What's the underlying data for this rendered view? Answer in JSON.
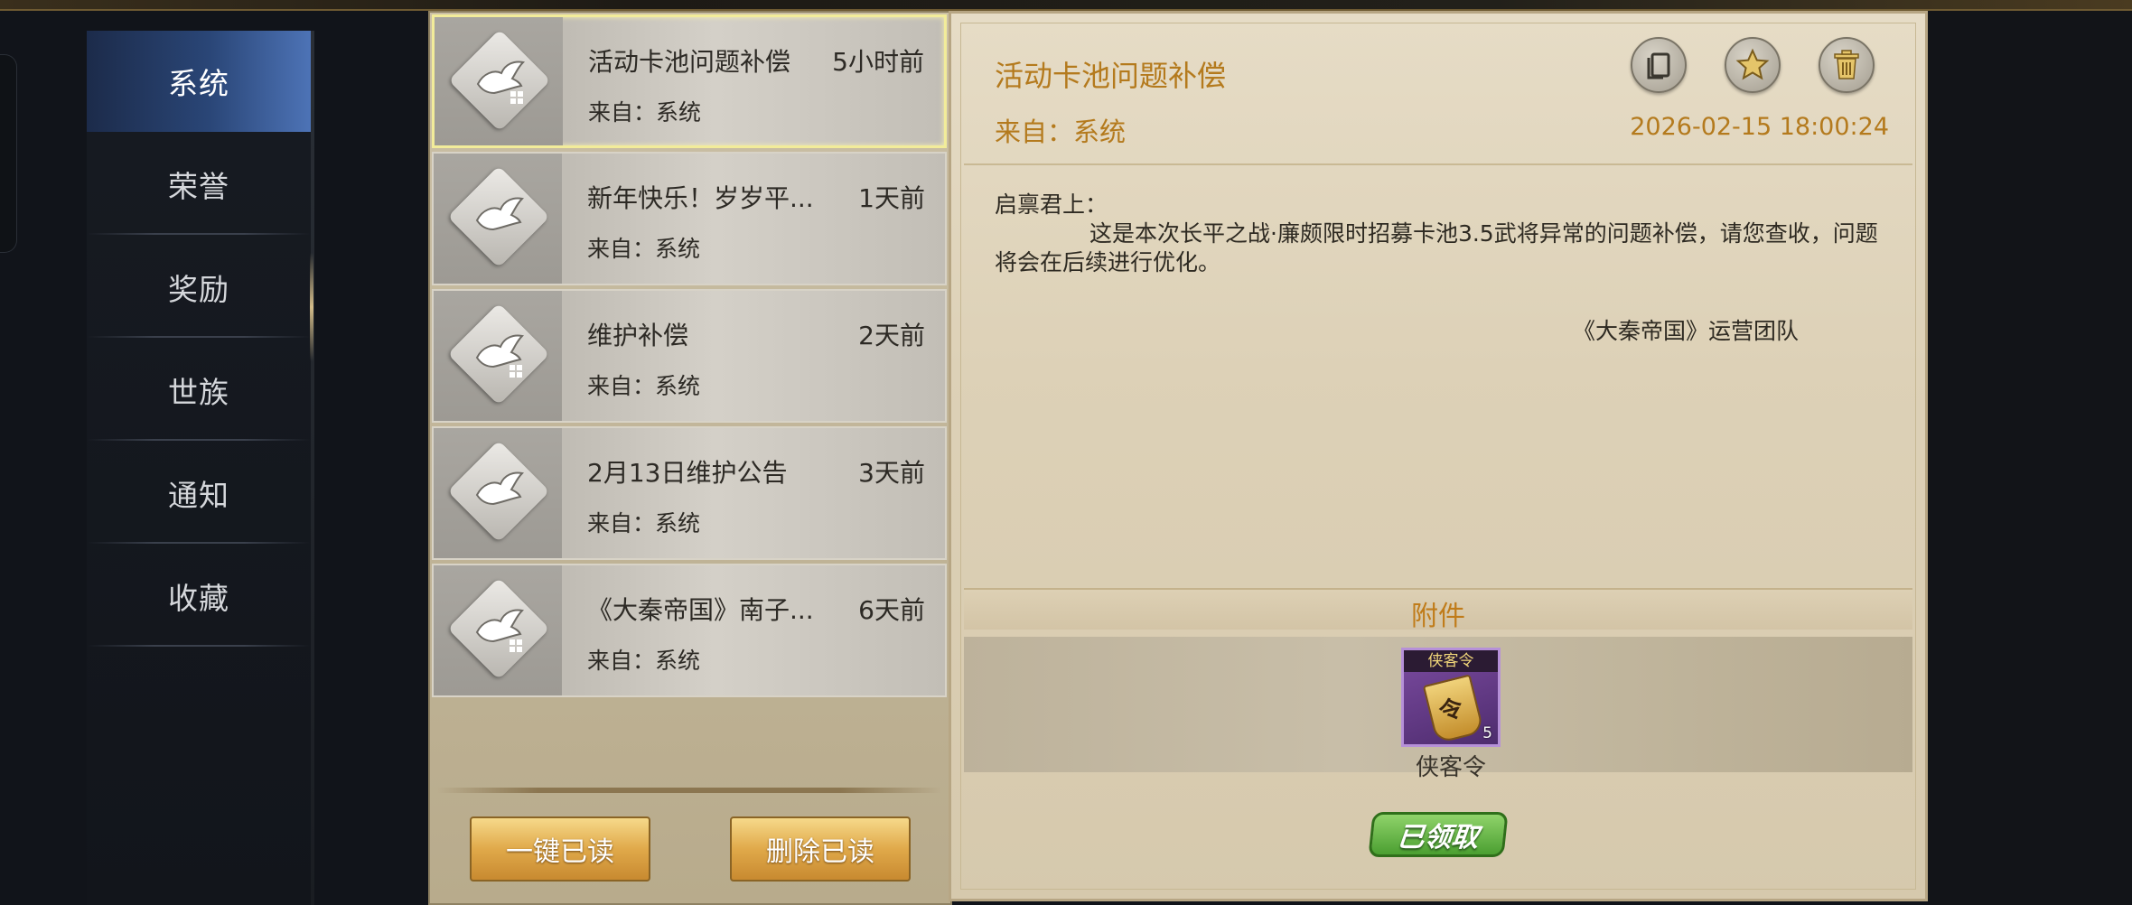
{
  "nav": {
    "items": [
      {
        "label": "系统",
        "active": true
      },
      {
        "label": "荣誉",
        "active": false
      },
      {
        "label": "奖励",
        "active": false
      },
      {
        "label": "世族",
        "active": false
      },
      {
        "label": "通知",
        "active": false
      },
      {
        "label": "收藏",
        "active": false
      }
    ]
  },
  "mail_list": {
    "items": [
      {
        "title": "活动卡池问题补偿",
        "time": "5小时前",
        "from": "来自：系统",
        "selected": true
      },
      {
        "title": "新年快乐！岁岁平...",
        "time": "1天前",
        "from": "来自：系统",
        "selected": false
      },
      {
        "title": "维护补偿",
        "time": "2天前",
        "from": "来自：系统",
        "selected": false
      },
      {
        "title": "2月13日维护公告",
        "time": "3天前",
        "from": "来自：系统",
        "selected": false
      },
      {
        "title": "《大秦帝国》南子...",
        "time": "6天前",
        "from": "来自：系统",
        "selected": false
      }
    ],
    "mark_all_read_label": "一键已读",
    "delete_read_label": "删除已读"
  },
  "detail": {
    "title": "活动卡池问题补偿",
    "from": "来自：系统",
    "date": "2026-02-15 18:00:24",
    "salutation": "启禀君上：",
    "body": "这是本次长平之战·廉颇限时招募卡池3.5武将异常的问题补偿，请您查收，问题将会在后续进行优化。",
    "signature": "《大秦帝国》运营团队",
    "attachment_label": "附件",
    "attachment": {
      "tag": "侠客令",
      "name": "侠客令",
      "count": "5"
    },
    "claimed_label": "已领取",
    "icons": {
      "copy": "copy-icon",
      "favorite": "star-icon",
      "delete": "trash-icon"
    }
  },
  "colors": {
    "accent_gold": "#b47a1d",
    "nav_active": "#2a4677",
    "claimed_green": "#4b9f31"
  }
}
